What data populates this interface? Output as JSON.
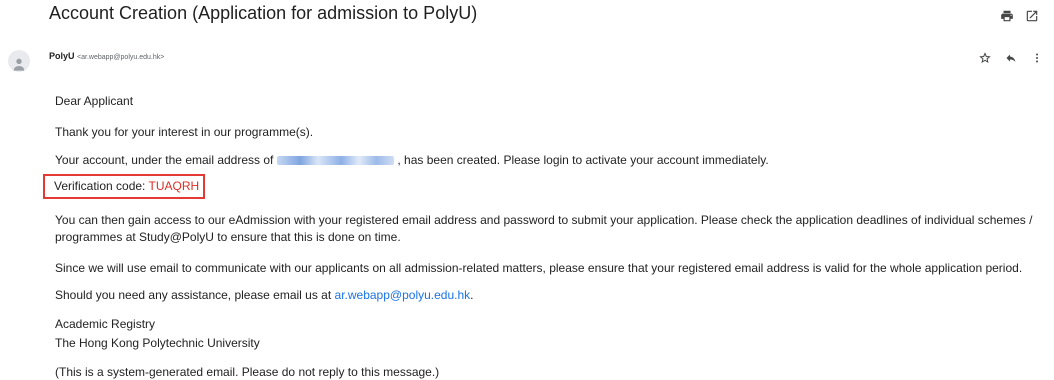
{
  "email": {
    "subject": "Account Creation (Application for admission to PolyU)",
    "toolbar_icons": [
      "print-icon",
      "open-in-new-window-icon"
    ],
    "sender": {
      "name": "PolyU",
      "email": "<ar.webapp@polyu.edu.hk>"
    },
    "message_icons": [
      "star-icon",
      "reply-icon",
      "more-options-icon"
    ],
    "body": {
      "greeting": "Dear Applicant",
      "thanks": "Thank you for your interest in our programme(s).",
      "account_before": "Your account, under the email address of",
      "account_after": ", has been created. Please login to activate your account immediately.",
      "code_label": "Verification code:",
      "code_value": "TUAQRH",
      "access": "You can then gain access to our eAdmission with your registered email address and password to submit your application. Please check the application deadlines of individual schemes / programmes at Study@PolyU to ensure that this is done on time.",
      "since": "Since we will use email to communicate with our applicants on all admission-related matters, please ensure that your registered email address is valid for the whole application period.",
      "assist_before": "Should you need any assistance, please email us at",
      "assist_link": "ar.webapp@polyu.edu.hk",
      "assist_after": ".",
      "signature_line1": "Academic Registry",
      "signature_line2": "The Hong Kong Polytechnic University",
      "system_note": "(This is a system-generated email. Please do not reply to this message.)"
    }
  },
  "colors": {
    "code_highlight_border": "#e53935",
    "code_value": "#d93025",
    "link": "#1a73e8"
  }
}
